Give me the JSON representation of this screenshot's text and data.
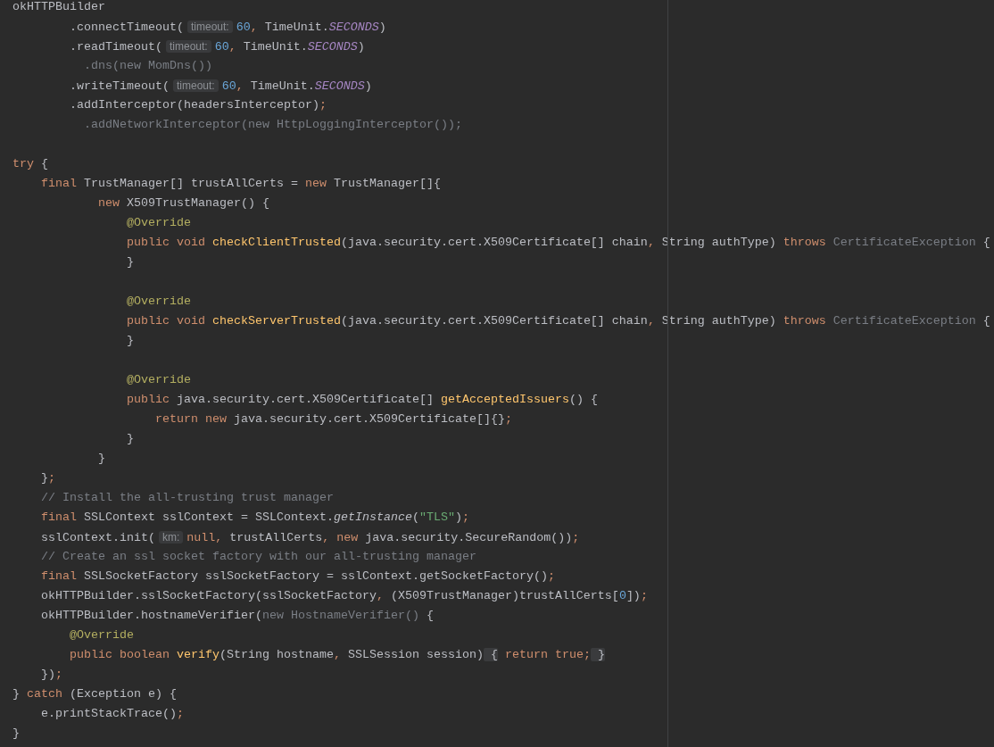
{
  "editor": {
    "lines": [
      {
        "tokens": [
          {
            "kind": "plain",
            "text": "okHTTPBuilder"
          }
        ]
      },
      {
        "tokens": [
          {
            "kind": "plain",
            "text": "        .connectTimeout("
          },
          {
            "kind": "hint",
            "text": "timeout:"
          },
          {
            "kind": "number",
            "text": "60"
          },
          {
            "kind": "punct",
            "text": ","
          },
          {
            "kind": "plain",
            "text": " TimeUnit."
          },
          {
            "kind": "static",
            "text": "SECONDS"
          },
          {
            "kind": "plain",
            "text": ")"
          }
        ]
      },
      {
        "tokens": [
          {
            "kind": "plain",
            "text": "        .readTimeout("
          },
          {
            "kind": "hint",
            "text": "timeout:"
          },
          {
            "kind": "number",
            "text": "60"
          },
          {
            "kind": "punct",
            "text": ","
          },
          {
            "kind": "plain",
            "text": " TimeUnit."
          },
          {
            "kind": "static",
            "text": "SECONDS"
          },
          {
            "kind": "plain",
            "text": ")"
          }
        ]
      },
      {
        "tokens": [
          {
            "kind": "dim",
            "text": "          .dns(new MomDns())"
          }
        ]
      },
      {
        "tokens": [
          {
            "kind": "plain",
            "text": "        .writeTimeout("
          },
          {
            "kind": "hint",
            "text": "timeout:"
          },
          {
            "kind": "number",
            "text": "60"
          },
          {
            "kind": "punct",
            "text": ","
          },
          {
            "kind": "plain",
            "text": " TimeUnit."
          },
          {
            "kind": "static",
            "text": "SECONDS"
          },
          {
            "kind": "plain",
            "text": ")"
          }
        ]
      },
      {
        "tokens": [
          {
            "kind": "plain",
            "text": "        .addInterceptor(headersInterceptor)"
          },
          {
            "kind": "punct",
            "text": ";"
          }
        ]
      },
      {
        "tokens": [
          {
            "kind": "dim",
            "text": "          .addNetworkInterceptor(new HttpLoggingInterceptor());"
          }
        ]
      },
      {
        "kind": "blank"
      },
      {
        "tokens": [
          {
            "kind": "keyword",
            "text": "try"
          },
          {
            "kind": "plain",
            "text": " {"
          }
        ]
      },
      {
        "tokens": [
          {
            "kind": "keyword",
            "text": "    final"
          },
          {
            "kind": "plain",
            "text": " TrustManager[] trustAllCerts = "
          },
          {
            "kind": "keyword",
            "text": "new"
          },
          {
            "kind": "plain",
            "text": " TrustManager[]{"
          }
        ]
      },
      {
        "tokens": [
          {
            "kind": "keyword",
            "text": "            new"
          },
          {
            "kind": "plain",
            "text": " X509TrustManager() {"
          }
        ]
      },
      {
        "tokens": [
          {
            "kind": "annotation",
            "text": "                @Override"
          }
        ]
      },
      {
        "tokens": [
          {
            "kind": "keyword",
            "text": "                public void"
          },
          {
            "kind": "method",
            "text": " checkClientTrusted"
          },
          {
            "kind": "plain",
            "text": "(java.security.cert.X509Certificate[] chain"
          },
          {
            "kind": "punct",
            "text": ","
          },
          {
            "kind": "plain",
            "text": " String authType) "
          },
          {
            "kind": "keyword",
            "text": "throws"
          },
          {
            "kind": "dim",
            "text": " CertificateException"
          },
          {
            "kind": "plain",
            "text": " {"
          }
        ]
      },
      {
        "tokens": [
          {
            "kind": "plain",
            "text": "                }"
          }
        ]
      },
      {
        "kind": "blank"
      },
      {
        "tokens": [
          {
            "kind": "annotation",
            "text": "                @Override"
          }
        ]
      },
      {
        "tokens": [
          {
            "kind": "keyword",
            "text": "                public void"
          },
          {
            "kind": "method",
            "text": " checkServerTrusted"
          },
          {
            "kind": "plain",
            "text": "(java.security.cert.X509Certificate[] chain"
          },
          {
            "kind": "punct",
            "text": ","
          },
          {
            "kind": "plain",
            "text": " String authType) "
          },
          {
            "kind": "keyword",
            "text": "throws"
          },
          {
            "kind": "dim",
            "text": " CertificateException"
          },
          {
            "kind": "plain",
            "text": " {"
          }
        ]
      },
      {
        "tokens": [
          {
            "kind": "plain",
            "text": "                }"
          }
        ]
      },
      {
        "kind": "blank"
      },
      {
        "tokens": [
          {
            "kind": "annotation",
            "text": "                @Override"
          }
        ]
      },
      {
        "tokens": [
          {
            "kind": "keyword",
            "text": "                public"
          },
          {
            "kind": "plain",
            "text": " java.security.cert.X509Certificate[] "
          },
          {
            "kind": "method",
            "text": "getAcceptedIssuers"
          },
          {
            "kind": "plain",
            "text": "() {"
          }
        ]
      },
      {
        "tokens": [
          {
            "kind": "keyword",
            "text": "                    return new"
          },
          {
            "kind": "plain",
            "text": " java.security.cert.X509Certificate[]{}"
          },
          {
            "kind": "punct",
            "text": ";"
          }
        ]
      },
      {
        "tokens": [
          {
            "kind": "plain",
            "text": "                }"
          }
        ]
      },
      {
        "tokens": [
          {
            "kind": "plain",
            "text": "            }"
          }
        ]
      },
      {
        "tokens": [
          {
            "kind": "plain",
            "text": "    }"
          },
          {
            "kind": "punct",
            "text": ";"
          }
        ]
      },
      {
        "tokens": [
          {
            "kind": "comment",
            "text": "    // Install the all-trusting trust manager"
          }
        ]
      },
      {
        "tokens": [
          {
            "kind": "keyword",
            "text": "    final"
          },
          {
            "kind": "plain",
            "text": " SSLContext sslContext = SSLContext."
          },
          {
            "kind": "italic",
            "text": "getInstance"
          },
          {
            "kind": "plain",
            "text": "("
          },
          {
            "kind": "string",
            "text": "\"TLS\""
          },
          {
            "kind": "plain",
            "text": ")"
          },
          {
            "kind": "punct",
            "text": ";"
          }
        ]
      },
      {
        "tokens": [
          {
            "kind": "plain",
            "text": "    sslContext.init("
          },
          {
            "kind": "hint",
            "text": "km:"
          },
          {
            "kind": "keyword",
            "text": "null"
          },
          {
            "kind": "punct",
            "text": ","
          },
          {
            "kind": "plain",
            "text": " trustAllCerts"
          },
          {
            "kind": "punct",
            "text": ","
          },
          {
            "kind": "keyword",
            "text": " new"
          },
          {
            "kind": "plain",
            "text": " java.security.SecureRandom())"
          },
          {
            "kind": "punct",
            "text": ";"
          }
        ]
      },
      {
        "tokens": [
          {
            "kind": "comment",
            "text": "    // Create an ssl socket factory with our all-trusting manager"
          }
        ]
      },
      {
        "tokens": [
          {
            "kind": "keyword",
            "text": "    final"
          },
          {
            "kind": "plain",
            "text": " SSLSocketFactory sslSocketFactory = sslContext.getSocketFactory()"
          },
          {
            "kind": "punct",
            "text": ";"
          }
        ]
      },
      {
        "tokens": [
          {
            "kind": "plain",
            "text": "    okHTTPBuilder.sslSocketFactory(sslSocketFactory"
          },
          {
            "kind": "punct",
            "text": ","
          },
          {
            "kind": "plain",
            "text": " (X509TrustManager)trustAllCerts["
          },
          {
            "kind": "number",
            "text": "0"
          },
          {
            "kind": "plain",
            "text": "])"
          },
          {
            "kind": "punct",
            "text": ";"
          }
        ]
      },
      {
        "tokens": [
          {
            "kind": "plain",
            "text": "    okHTTPBuilder.hostnameVerifier("
          },
          {
            "kind": "dim",
            "text": "new HostnameVerifier()"
          },
          {
            "kind": "plain",
            "text": " {"
          }
        ]
      },
      {
        "tokens": [
          {
            "kind": "annotation",
            "text": "        @Override"
          }
        ]
      },
      {
        "tokens": [
          {
            "kind": "keyword",
            "text": "        public boolean"
          },
          {
            "kind": "method",
            "text": " verify"
          },
          {
            "kind": "plain",
            "text": "(String hostname"
          },
          {
            "kind": "punct",
            "text": ","
          },
          {
            "kind": "plain",
            "text": " SSLSession session)"
          },
          {
            "kind": "fold",
            "text": " {"
          },
          {
            "kind": "keyword",
            "text": " return true"
          },
          {
            "kind": "punct",
            "text": ";"
          },
          {
            "kind": "fold",
            "text": " }"
          }
        ]
      },
      {
        "tokens": [
          {
            "kind": "plain",
            "text": "    })"
          },
          {
            "kind": "punct",
            "text": ";"
          }
        ]
      },
      {
        "tokens": [
          {
            "kind": "plain",
            "text": "} "
          },
          {
            "kind": "keyword",
            "text": "catch"
          },
          {
            "kind": "plain",
            "text": " (Exception e) {"
          }
        ]
      },
      {
        "tokens": [
          {
            "kind": "plain",
            "text": "    e.printStackTrace()"
          },
          {
            "kind": "punct",
            "text": ";"
          }
        ]
      },
      {
        "tokens": [
          {
            "kind": "plain",
            "text": "}"
          }
        ]
      }
    ]
  }
}
